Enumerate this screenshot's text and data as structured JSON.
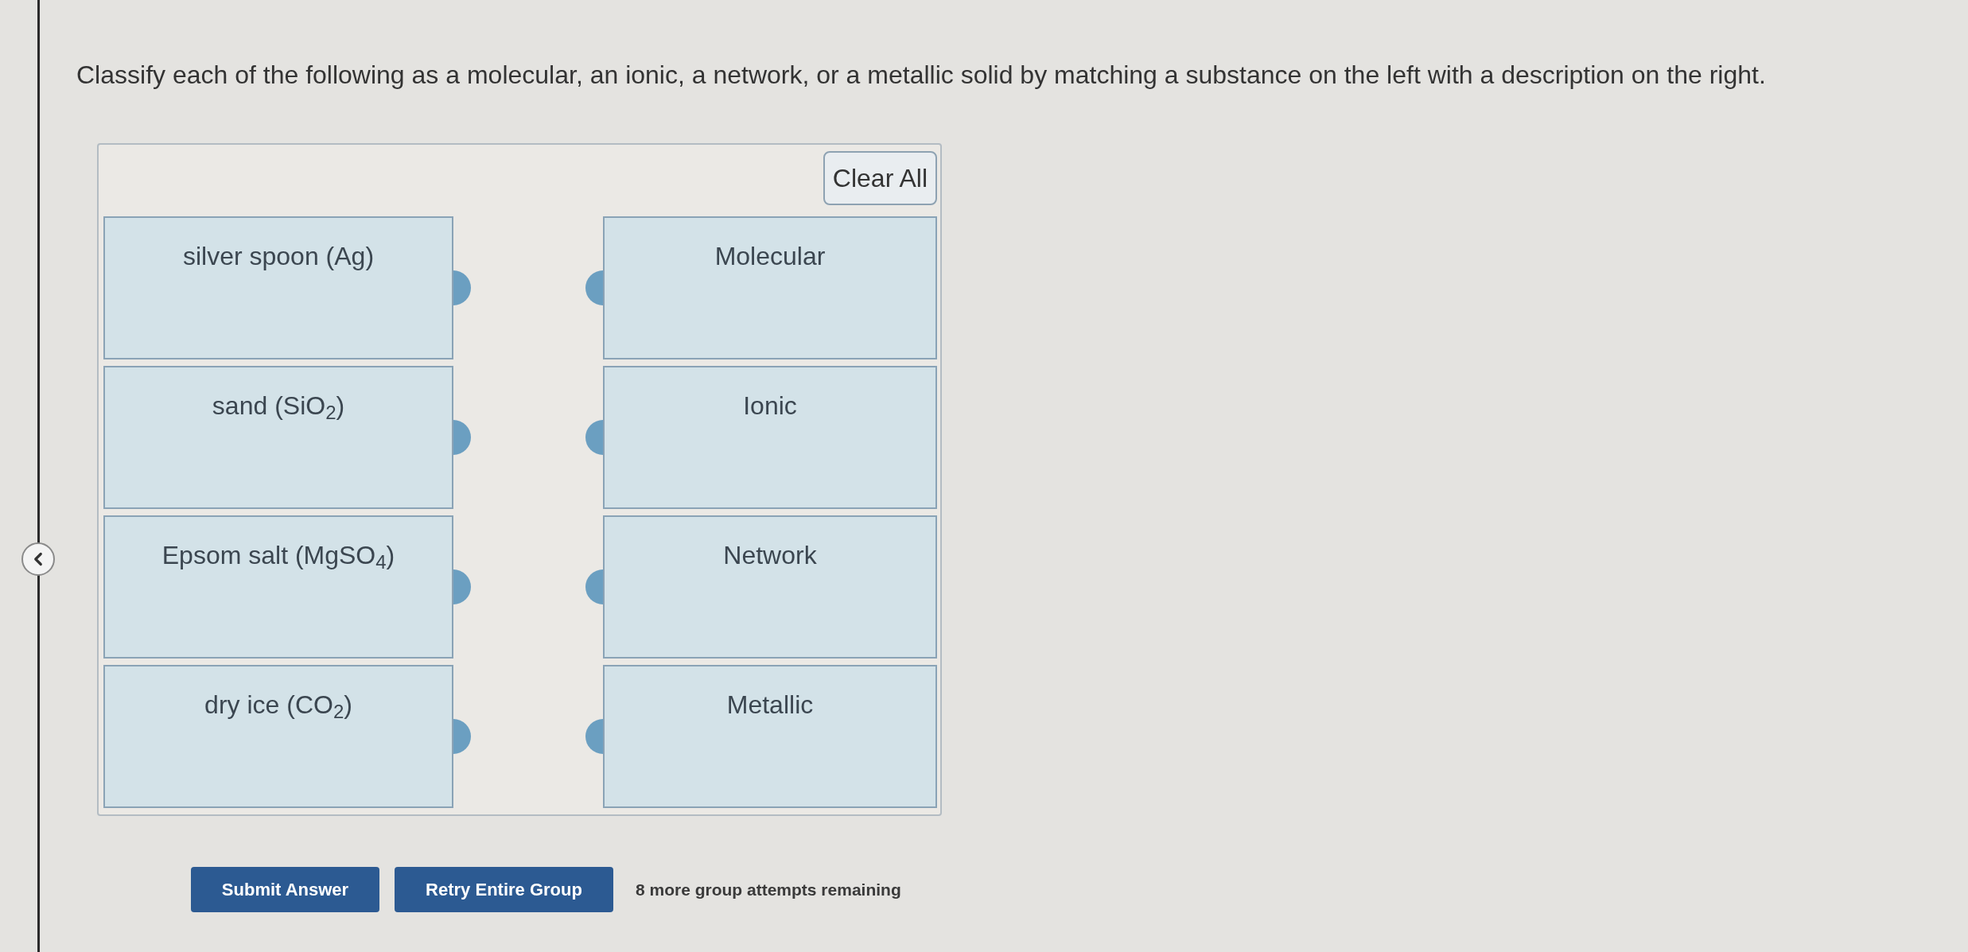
{
  "question": "Classify each of the following as a molecular, an ionic, a network, or a metallic solid by matching a substance on the left with a description on the right.",
  "matching": {
    "clear_button": "Clear All",
    "substances": [
      "silver spoon (Ag)",
      "sand (SiO$_{2}$)",
      "Epsom salt (MgSO$_{4}$)",
      "dry ice (CO$_{2}$)"
    ],
    "categories": [
      "Molecular",
      "Ionic",
      "Network",
      "Metallic"
    ]
  },
  "actions": {
    "submit_button": "Submit Answer",
    "retry_button": "Retry Entire Group",
    "attempts_note": "8 more group attempts remaining"
  }
}
